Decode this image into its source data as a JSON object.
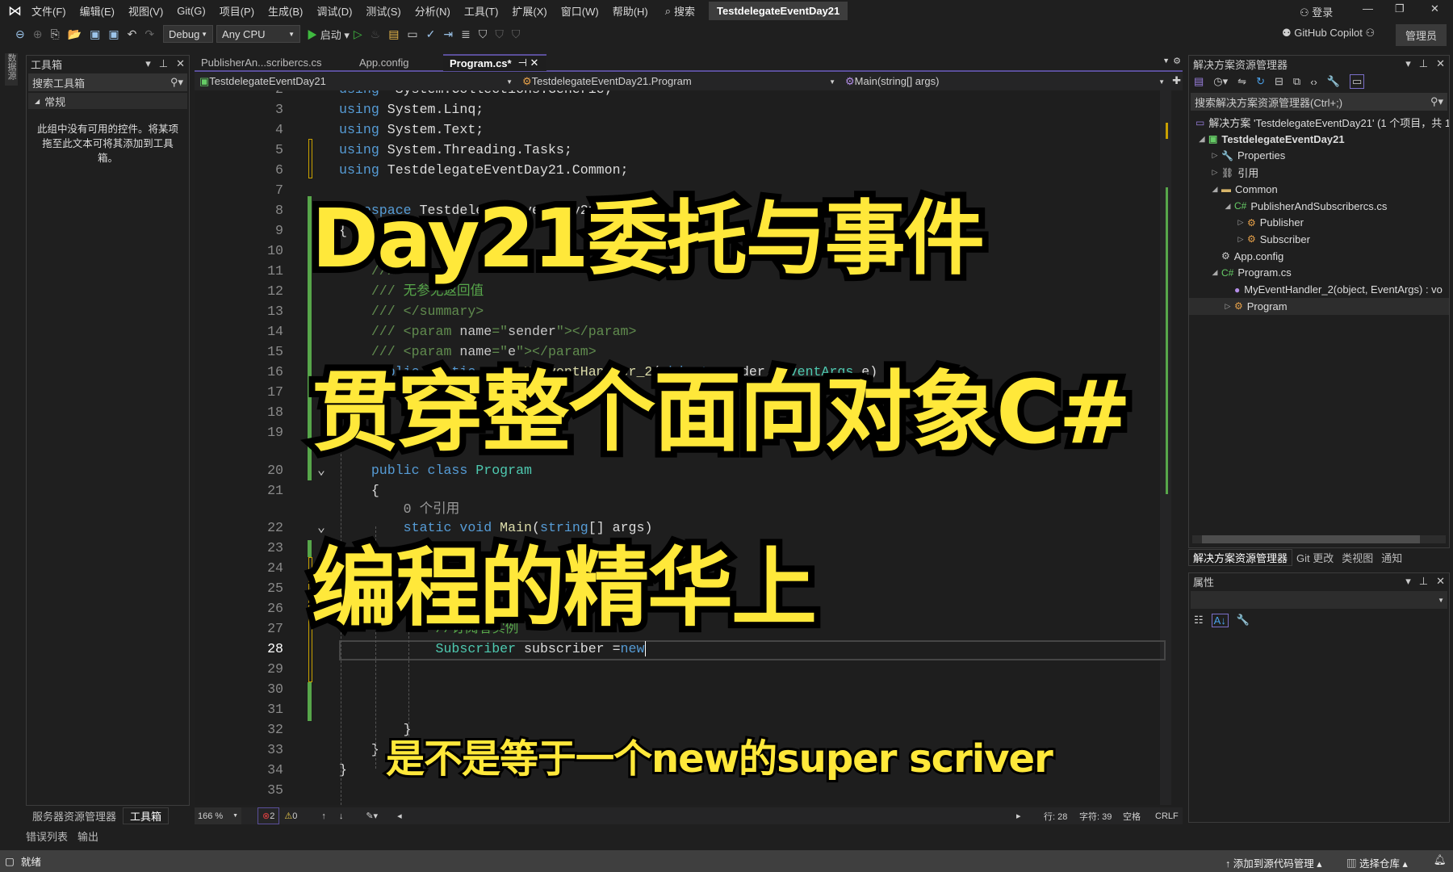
{
  "menubar": {
    "items": [
      "文件(F)",
      "编辑(E)",
      "视图(V)",
      "Git(G)",
      "项目(P)",
      "生成(B)",
      "调试(D)",
      "测试(S)",
      "分析(N)",
      "工具(T)",
      "扩展(X)",
      "窗口(W)",
      "帮助(H)"
    ],
    "search": "搜索",
    "title": "TestdelegateEventDay21",
    "login": "登录"
  },
  "toolbar": {
    "config": "Debug",
    "platform": "Any CPU",
    "start": "启动",
    "copilot": "GitHub Copilot",
    "admin": "管理员"
  },
  "left_strip": {
    "label": "数据源"
  },
  "toolbox": {
    "title": "工具箱",
    "search_placeholder": "搜索工具箱",
    "group": "常规",
    "empty_text": "此组中没有可用的控件。将某项拖至此文本可将其添加到工具箱。",
    "tabs": [
      "服务器资源管理器",
      "工具箱"
    ]
  },
  "editor": {
    "tabs": [
      {
        "label": "PublisherAn...scribercs.cs"
      },
      {
        "label": "App.config"
      },
      {
        "label": "Program.cs*",
        "active": true
      }
    ],
    "nav": {
      "project": "TestdelegateEventDay21",
      "class": "TestdelegateEventDay21.Program",
      "member": "Main(string[] args)"
    },
    "lines": [
      {
        "n": "2",
        "segs": [
          [
            "kw",
            "using"
          ],
          [
            "",
            "  System.Collections.Generic;"
          ]
        ]
      },
      {
        "n": "3",
        "segs": [
          [
            "kw",
            "using"
          ],
          [
            "",
            " System.Linq;"
          ]
        ]
      },
      {
        "n": "4",
        "segs": [
          [
            "kw",
            "using"
          ],
          [
            "",
            " System.Text;"
          ]
        ]
      },
      {
        "n": "5",
        "segs": [
          [
            "kw",
            "using"
          ],
          [
            "",
            " System.Threading.Tasks;"
          ]
        ]
      },
      {
        "n": "6",
        "segs": [
          [
            "kw",
            "using"
          ],
          [
            "",
            " TestdelegateEventDay21.Common;"
          ]
        ]
      },
      {
        "n": "7",
        "segs": []
      },
      {
        "n": "8",
        "segs": [
          [
            "kw",
            "namespace"
          ],
          [
            "",
            " TestdelegateEventDay21"
          ]
        ]
      },
      {
        "n": "9",
        "segs": [
          [
            "",
            "{"
          ]
        ]
      },
      {
        "n": "10",
        "segs": []
      },
      {
        "n": "11",
        "segs": [
          [
            "xd",
            "    ///"
          ]
        ]
      },
      {
        "n": "12",
        "segs": [
          [
            "xd",
            "    ///"
          ],
          [
            "cm",
            " 无参无返回值"
          ]
        ]
      },
      {
        "n": "13",
        "segs": [
          [
            "xd",
            "    /// </summary>"
          ]
        ]
      },
      {
        "n": "14",
        "segs": [
          [
            "xd",
            "    /// <param "
          ],
          [
            "xs",
            "name"
          ],
          [
            "xd",
            "=\""
          ],
          [
            "xs",
            "sender"
          ],
          [
            "xd",
            "\"></param>"
          ]
        ]
      },
      {
        "n": "15",
        "segs": [
          [
            "xd",
            "    /// <param "
          ],
          [
            "xs",
            "name"
          ],
          [
            "xd",
            "=\""
          ],
          [
            "xs",
            "e"
          ],
          [
            "xd",
            "\"></param>"
          ]
        ]
      },
      {
        "n": "16",
        "segs": [
          [
            "kw",
            "    public static void"
          ],
          [
            "",
            " "
          ],
          [
            "fn",
            "MyEventHandler_2"
          ],
          [
            "",
            "("
          ],
          [
            "kw",
            "object"
          ],
          [
            "",
            " sender, "
          ],
          [
            "ty",
            "EventArgs"
          ],
          [
            "",
            " e)"
          ]
        ]
      },
      {
        "n": "17",
        "segs": []
      },
      {
        "n": "18",
        "segs": []
      },
      {
        "n": "19",
        "segs": []
      },
      {
        "lens": true,
        "segs": []
      },
      {
        "n": "20",
        "fold": true,
        "segs": [
          [
            "kw",
            "    public class"
          ],
          [
            "",
            " "
          ],
          [
            "ty",
            "Program"
          ]
        ]
      },
      {
        "n": "21",
        "segs": [
          [
            "",
            "    {"
          ]
        ]
      },
      {
        "lens": true,
        "segs": [
          [
            "lens",
            "        0 个引用"
          ]
        ]
      },
      {
        "n": "22",
        "fold": true,
        "segs": [
          [
            "kw",
            "        static void"
          ],
          [
            "",
            " "
          ],
          [
            "fn",
            "Main"
          ],
          [
            "",
            "("
          ],
          [
            "kw",
            "string"
          ],
          [
            "",
            "[] args)"
          ]
        ]
      },
      {
        "n": "23",
        "segs": []
      },
      {
        "n": "24",
        "segs": []
      },
      {
        "n": "25",
        "segs": []
      },
      {
        "n": "26",
        "segs": []
      },
      {
        "n": "27",
        "segs": [
          [
            "cm",
            "            //订阅者实例"
          ]
        ]
      },
      {
        "n": "28",
        "current": true,
        "segs": [
          [
            "ty",
            "            Subscriber"
          ],
          [
            "",
            " subscriber ="
          ],
          [
            "kw",
            "new"
          ]
        ]
      },
      {
        "n": "29",
        "segs": []
      },
      {
        "n": "30",
        "segs": []
      },
      {
        "n": "31",
        "segs": []
      },
      {
        "n": "32",
        "segs": [
          [
            "",
            "        }"
          ]
        ]
      },
      {
        "n": "33",
        "segs": [
          [
            "",
            "    }"
          ]
        ]
      },
      {
        "n": "34",
        "segs": [
          [
            "",
            "}"
          ]
        ]
      },
      {
        "n": "35",
        "segs": []
      }
    ],
    "status": {
      "zoom": "166 %",
      "errors": "2",
      "warnings": "0",
      "line": "行: 28",
      "char": "字符: 39",
      "spaces": "空格",
      "eol": "CRLF"
    }
  },
  "overlay": {
    "line1": "Day21委托与事件",
    "line2": "贯穿整个面向对象C#",
    "line3": "编程的精华上",
    "subtitle": "是不是等于一个new的super scriver"
  },
  "solution_explorer": {
    "title": "解决方案资源管理器",
    "search_placeholder": "搜索解决方案资源管理器(Ctrl+;)",
    "items": [
      {
        "label": "解决方案 'TestdelegateEventDay21' (1 个项目，共 1",
        "icon": "solution-icon",
        "depth": 0,
        "tri": ""
      },
      {
        "label": "TestdelegateEventDay21",
        "icon": "csproj-icon",
        "depth": 0,
        "tri": "◢",
        "bold": true
      },
      {
        "label": "Properties",
        "icon": "wrench-icon",
        "depth": 1,
        "tri": "▷"
      },
      {
        "label": "引用",
        "icon": "references-icon",
        "depth": 1,
        "tri": "▷"
      },
      {
        "label": "Common",
        "icon": "folder-icon",
        "depth": 1,
        "tri": "◢"
      },
      {
        "label": "PublisherAndSubscribercs.cs",
        "icon": "csharp-file-icon",
        "depth": 2,
        "tri": "◢"
      },
      {
        "label": "Publisher",
        "icon": "class-icon",
        "depth": 3,
        "tri": "▷"
      },
      {
        "label": "Subscriber",
        "icon": "class-icon",
        "depth": 3,
        "tri": "▷"
      },
      {
        "label": "App.config",
        "icon": "config-icon",
        "depth": 1,
        "tri": ""
      },
      {
        "label": "Program.cs",
        "icon": "csharp-file-icon",
        "depth": 1,
        "tri": "◢"
      },
      {
        "label": "MyEventHandler_2(object, EventArgs) : vo",
        "icon": "method-icon",
        "depth": 2,
        "tri": ""
      },
      {
        "label": "Program",
        "icon": "class-icon",
        "depth": 2,
        "tri": "▷",
        "selected": true
      }
    ],
    "tabs": [
      "解决方案资源管理器",
      "Git 更改",
      "类视图",
      "通知"
    ]
  },
  "properties": {
    "title": "属性"
  },
  "bottom_tabs": [
    "错误列表",
    "输出"
  ],
  "statusbar": {
    "ready": "就绪",
    "source_control": "添加到源代码管理",
    "repo": "选择仓库"
  },
  "colors": {
    "overlay_yellow": "#ffe83a",
    "keyword": "#569cd6",
    "type": "#4ec9b0",
    "comment": "#57a64a",
    "change_added": "#57a64a",
    "change_saved": "#c8a000"
  }
}
